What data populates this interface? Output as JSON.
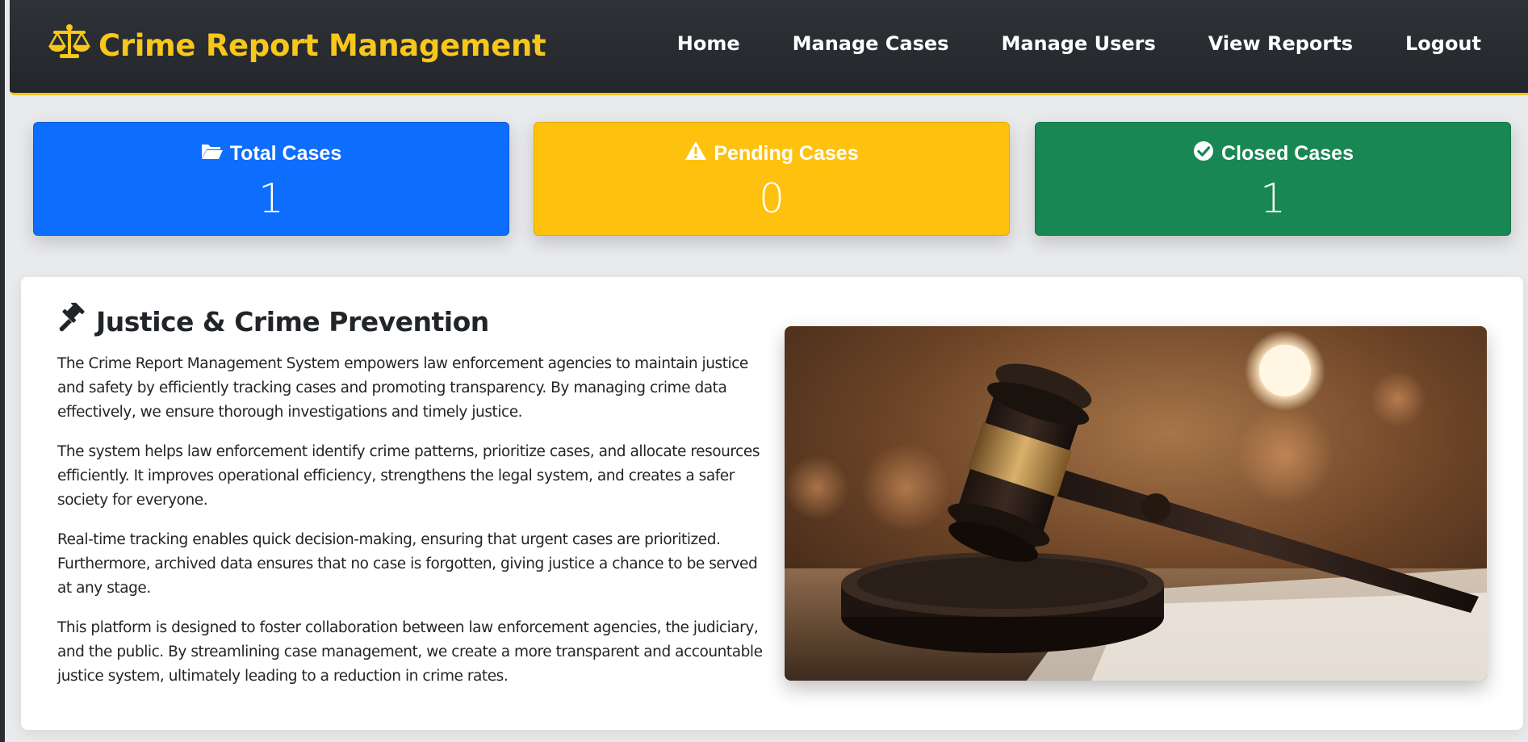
{
  "nav": {
    "brand": "Crime Report Management",
    "brand_icon": "balance-scale-icon",
    "links": [
      "Home",
      "Manage Cases",
      "Manage Users",
      "View Reports",
      "Logout"
    ]
  },
  "stats": {
    "total": {
      "label": "Total Cases",
      "value": "1",
      "icon": "folder-open-icon",
      "color": "#0d6efd"
    },
    "pending": {
      "label": "Pending Cases",
      "value": "0",
      "icon": "warning-icon",
      "color": "#ffc107"
    },
    "closed": {
      "label": "Closed Cases",
      "value": "1",
      "icon": "check-circle-icon",
      "color": "#198754"
    }
  },
  "about": {
    "title": "Justice & Crime Prevention",
    "title_icon": "gavel-icon",
    "paragraphs": [
      "The Crime Report Management System empowers law enforcement agencies to maintain justice and safety by efficiently tracking cases and promoting transparency. By managing crime data effectively, we ensure thorough investigations and timely justice.",
      "The system helps law enforcement identify crime patterns, prioritize cases, and allocate resources efficiently. It improves operational efficiency, strengthens the legal system, and creates a safer society for everyone.",
      "Real-time tracking enables quick decision-making, ensuring that urgent cases are prioritized. Furthermore, archived data ensures that no case is forgotten, giving justice a chance to be served at any stage.",
      "This platform is designed to foster collaboration between law enforcement agencies, the judiciary, and the public. By streamlining case management, we create a more transparent and accountable justice system, ultimately leading to a reduction in crime rates."
    ]
  },
  "colors": {
    "accent": "#f7c71b",
    "navbar": "#2a2d31"
  }
}
